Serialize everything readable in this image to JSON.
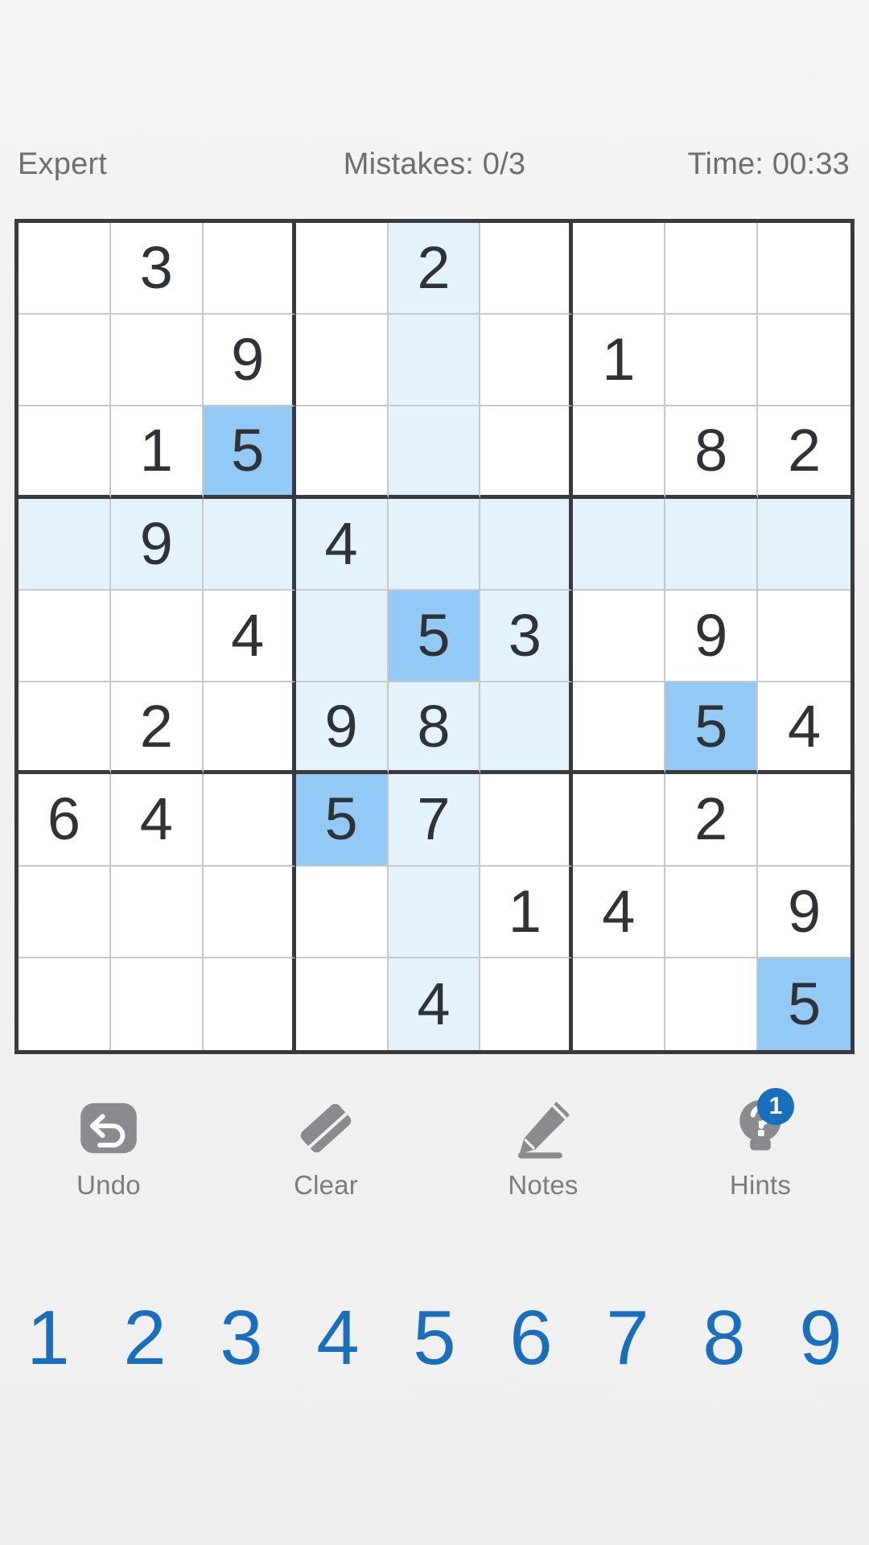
{
  "status": {
    "difficulty": "Expert",
    "mistakes": "Mistakes: 0/3",
    "timer": "Time: 00:33"
  },
  "board": {
    "rows": [
      [
        "",
        "3",
        "",
        "",
        "2",
        "",
        "",
        "",
        ""
      ],
      [
        "",
        "",
        "9",
        "",
        "",
        "",
        "1",
        "",
        ""
      ],
      [
        "",
        "1",
        "5",
        "",
        "",
        "",
        "",
        "8",
        "2"
      ],
      [
        "",
        "9",
        "",
        "4",
        "",
        "",
        "",
        "",
        ""
      ],
      [
        "",
        "",
        "4",
        "",
        "5",
        "3",
        "",
        "9",
        ""
      ],
      [
        "",
        "2",
        "",
        "9",
        "8",
        "",
        "",
        "5",
        "4"
      ],
      [
        "6",
        "4",
        "",
        "5",
        "7",
        "",
        "",
        "2",
        ""
      ],
      [
        "",
        "",
        "",
        "",
        "",
        "1",
        "4",
        "",
        "9"
      ],
      [
        "",
        "",
        "",
        "",
        "4",
        "",
        "",
        "",
        "5"
      ]
    ],
    "highlight": [
      [
        "",
        "",
        "",
        "",
        "soft",
        "",
        "",
        "",
        ""
      ],
      [
        "",
        "",
        "",
        "",
        "soft",
        "",
        "",
        "",
        ""
      ],
      [
        "",
        "",
        "match",
        "",
        "soft",
        "",
        "",
        "",
        ""
      ],
      [
        "soft",
        "soft",
        "soft",
        "soft",
        "soft",
        "soft",
        "soft",
        "soft",
        "soft"
      ],
      [
        "",
        "",
        "",
        "soft",
        "match",
        "soft",
        "",
        "",
        ""
      ],
      [
        "",
        "",
        "",
        "soft",
        "soft",
        "soft",
        "",
        "match",
        ""
      ],
      [
        "",
        "",
        "",
        "match",
        "soft",
        "",
        "",
        "",
        ""
      ],
      [
        "",
        "",
        "",
        "",
        "soft",
        "",
        "",
        "",
        ""
      ],
      [
        "",
        "",
        "",
        "",
        "soft",
        "",
        "",
        "",
        "match"
      ]
    ],
    "colors": {
      "soft_highlight": "#e4f2fc",
      "match_highlight": "#93c9f5",
      "digit": "#2f3338",
      "thick_line": "#3a3a3e",
      "thin_line": "#c9c9c9"
    }
  },
  "toolbar": {
    "items": [
      {
        "icon": "undo-icon",
        "label": "Undo",
        "badge": ""
      },
      {
        "icon": "eraser-icon",
        "label": "Clear",
        "badge": ""
      },
      {
        "icon": "pencil-icon",
        "label": "Notes",
        "badge": ""
      },
      {
        "icon": "lightbulb-question-icon",
        "label": "Hints",
        "badge": "1"
      }
    ],
    "icon_color": "#8a8a8f",
    "badge_color": "#1a6fbd"
  },
  "numpad": {
    "keys": [
      "1",
      "2",
      "3",
      "4",
      "5",
      "6",
      "7",
      "8",
      "9"
    ],
    "color": "#1a6fbd"
  }
}
